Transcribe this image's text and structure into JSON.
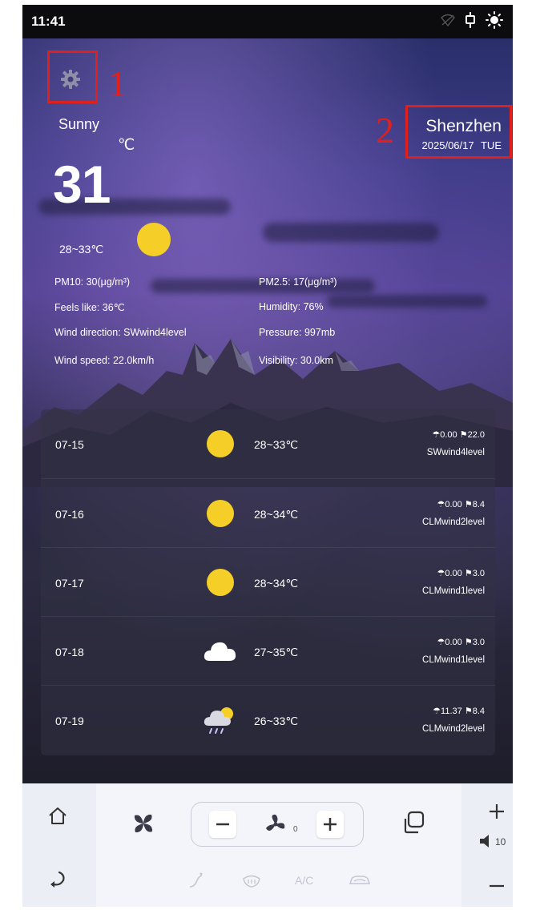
{
  "status_bar": {
    "time": "11:41",
    "icons": [
      "wifi-off-icon",
      "usb-icon",
      "brightness-icon"
    ]
  },
  "annotations": {
    "label_1": "1",
    "label_2": "2",
    "box_color": "#e0201c"
  },
  "location": {
    "city": "Shenzhen",
    "date": "2025/06/17  TUE"
  },
  "current": {
    "condition": "Sunny",
    "unit": "℃",
    "temperature": "31",
    "range": "28~33℃",
    "icon": "sun-icon"
  },
  "details": {
    "pm10": "PM10: 30(μg/m³)",
    "pm25": "PM2.5: 17(μg/m³)",
    "feels_like": "Feels like: 36℃",
    "humidity": "Humidity: 76%",
    "wind_direction": "Wind direction: SWwind4level",
    "pressure": "Pressure: 997mb",
    "wind_speed": "Wind speed: 22.0km/h",
    "visibility": "Visibility: 30.0km"
  },
  "forecast": [
    {
      "date": "07-15",
      "icon": "sun-icon",
      "temp": "28~33℃",
      "rain": "0.00",
      "wind": "22.0",
      "wind_level": "SWwind4level"
    },
    {
      "date": "07-16",
      "icon": "sun-icon",
      "temp": "28~34℃",
      "rain": "0.00",
      "wind": "8.4",
      "wind_level": "CLMwind2level"
    },
    {
      "date": "07-17",
      "icon": "sun-icon",
      "temp": "28~34℃",
      "rain": "0.00",
      "wind": "3.0",
      "wind_level": "CLMwind1level"
    },
    {
      "date": "07-18",
      "icon": "cloud-icon",
      "temp": "27~35℃",
      "rain": "0.00",
      "wind": "3.0",
      "wind_level": "CLMwind1level"
    },
    {
      "date": "07-19",
      "icon": "rain-sun-icon",
      "temp": "26~33℃",
      "rain": "11.37",
      "wind": "8.4",
      "wind_level": "CLMwind2level"
    }
  ],
  "bottom_bar": {
    "fan_level": "0",
    "volume": "10",
    "ac_label": "A/C",
    "icons": [
      "home-icon",
      "back-icon",
      "fan-icon",
      "minus-icon",
      "fan-speed-icon",
      "plus-icon",
      "recent-apps-icon",
      "volume-up-icon",
      "volume-icon",
      "volume-down-icon",
      "heater-icon",
      "defrost-icon",
      "car-recirculation-icon"
    ]
  },
  "colors": {
    "sun": "#f5cf27",
    "accent_red": "#e0201c"
  }
}
